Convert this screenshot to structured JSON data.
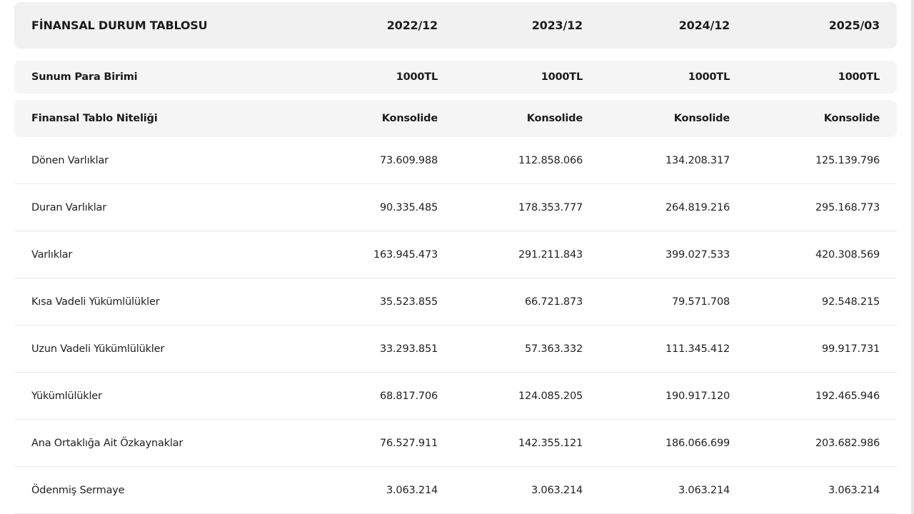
{
  "table": {
    "header": {
      "title": "FİNANSAL DURUM TABLOSU",
      "periods": [
        "2022/12",
        "2023/12",
        "2024/12",
        "2025/03"
      ]
    },
    "currency_row": {
      "label": "Sunum Para Birimi",
      "values": [
        "1000TL",
        "1000TL",
        "1000TL",
        "1000TL"
      ]
    },
    "nature_row": {
      "label": "Finansal Tablo Niteliği",
      "values": [
        "Konsolide",
        "Konsolide",
        "Konsolide",
        "Konsolide"
      ]
    },
    "rows": [
      {
        "label": "Dönen Varlıklar",
        "values": [
          "73.609.988",
          "112.858.066",
          "134.208.317",
          "125.139.796"
        ]
      },
      {
        "label": "Duran Varlıklar",
        "values": [
          "90.335.485",
          "178.353.777",
          "264.819.216",
          "295.168.773"
        ]
      },
      {
        "label": "Varlıklar",
        "values": [
          "163.945.473",
          "291.211.843",
          "399.027.533",
          "420.308.569"
        ]
      },
      {
        "label": "Kısa Vadeli Yükümlülükler",
        "values": [
          "35.523.855",
          "66.721.873",
          "79.571.708",
          "92.548.215"
        ]
      },
      {
        "label": "Uzun Vadeli Yükümlülükler",
        "values": [
          "33.293.851",
          "57.363.332",
          "111.345.412",
          "99.917.731"
        ]
      },
      {
        "label": "Yükümlülükler",
        "values": [
          "68.817.706",
          "124.085.205",
          "190.917.120",
          "192.465.946"
        ]
      },
      {
        "label": "Ana Ortaklığa Ait Özkaynaklar",
        "values": [
          "76.527.911",
          "142.355.121",
          "186.066.699",
          "203.682.986"
        ]
      },
      {
        "label": "Ödenmiş Sermaye",
        "values": [
          "3.063.214",
          "3.063.214",
          "3.063.214",
          "3.063.214"
        ]
      }
    ]
  }
}
